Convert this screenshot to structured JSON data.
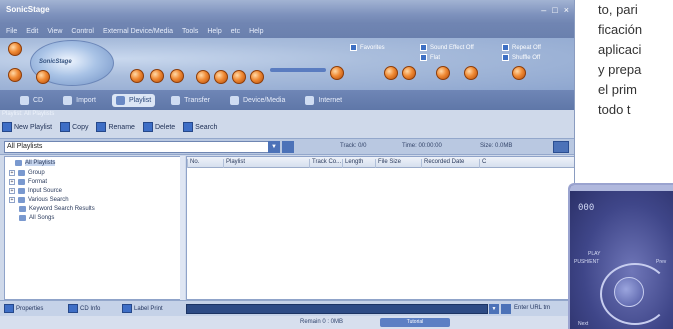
{
  "window": {
    "title": "SonicStage",
    "controls": [
      "–",
      "□",
      "×"
    ]
  },
  "menu": [
    "File",
    "Edit",
    "View",
    "Control",
    "External Device/Media",
    "Tools",
    "Help",
    "etc",
    "Help"
  ],
  "player": {
    "toggles": [
      "Favorites",
      "Sound Effect Off",
      "Repeat Off",
      "Flat",
      "Shuffle Off"
    ]
  },
  "nav": {
    "tabs": [
      "CD",
      "Import",
      "Playlist",
      "Transfer",
      "Device/Media",
      "Internet"
    ],
    "active_tab": "Playlist"
  },
  "path": "Playlist: All Playlists",
  "actions": [
    "New Playlist",
    "Copy",
    "Rename",
    "Delete",
    "Search"
  ],
  "filter": {
    "combo_value": "All Playlists",
    "track": "Track: 0/0",
    "time": "Time: 00:00:00",
    "size": "Size: 0.0MB"
  },
  "tree": [
    {
      "label": "All Playlists",
      "expander": "",
      "selected": true
    },
    {
      "label": "Group",
      "expander": "+",
      "selected": false
    },
    {
      "label": "Format",
      "expander": "+",
      "selected": false
    },
    {
      "label": "Input Source",
      "expander": "+",
      "selected": false
    },
    {
      "label": "Various Search",
      "expander": "+",
      "selected": false
    },
    {
      "label": "Keyword Search Results",
      "expander": "",
      "selected": false
    },
    {
      "label": "All Songs",
      "expander": "",
      "selected": false
    }
  ],
  "grid": {
    "columns": [
      "No.",
      "Playlist",
      "Track Co...",
      "Length",
      "File Size",
      "Recorded Date",
      "C"
    ]
  },
  "bottom": {
    "tabs": [
      "Properties",
      "CD Info",
      "Label Print"
    ],
    "url_label": "Enter URL tm"
  },
  "status": {
    "text": "Remain 0 : 0MB",
    "pill": "Tutorial"
  },
  "article": {
    "lines": [
      "to, pari",
      "ficación",
      "aplicaci",
      "y prepa",
      "el prim",
      "todo t"
    ]
  },
  "miniplayer": {
    "number": "000",
    "labels": [
      "PLAY",
      "PUSH/ENT",
      "Next",
      "Prev"
    ]
  }
}
